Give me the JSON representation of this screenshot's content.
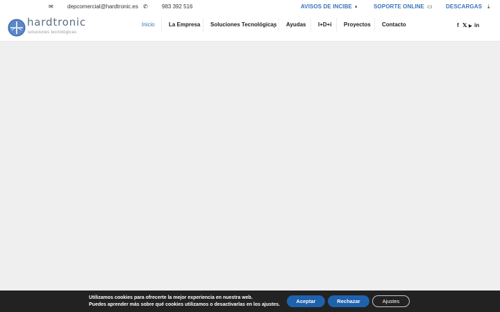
{
  "topbar": {
    "email": "depcomercial@hardtronic.es",
    "phone": "983 392 516",
    "links": [
      "AVISOS DE INCIBE",
      "SOPORTE ONLINE",
      "DESCARGAS"
    ]
  },
  "logo": {
    "name": "hardtronic",
    "tagline": "soluciones tecnológicas"
  },
  "nav": {
    "items": [
      "Inicio",
      "La Empresa",
      "Soluciones Tecnológicas",
      "Ayudas",
      "I+D+i",
      "Proyectos",
      "Contacto"
    ]
  },
  "social": [
    "f",
    "𝕏",
    "▶",
    "in"
  ],
  "cookie": {
    "line1": "Utilizamos cookies para ofrecerte la mejor experiencia en nuestra web.",
    "line2": "Puedes aprender más sobre qué cookies utilizamos o desactivarlas en los ajustes.",
    "accept": "Aceptar",
    "reject": "Rechazar",
    "settings": "Ajustes"
  },
  "colors": {
    "accent": "#3b73b9",
    "button": "#1e62ad",
    "cookie_bg": "#222222"
  }
}
